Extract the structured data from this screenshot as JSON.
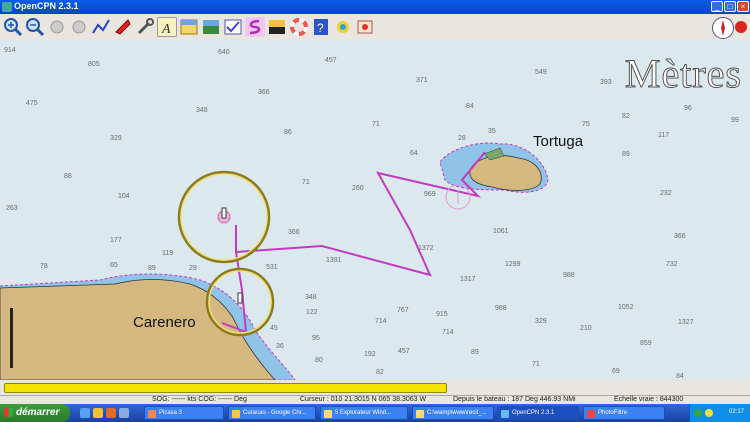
{
  "window": {
    "title": "OpenCPN 2.3.1"
  },
  "toolbar": {
    "buttons": [
      "zoom-in-icon",
      "zoom-out-icon",
      "scale-in-icon",
      "scale-out-icon",
      "route-icon",
      "follow-boat-icon",
      "settings-wrench-icon",
      "text-toggle-icon",
      "chart-quilt-icon",
      "current-icon",
      "tide-icon",
      "ais-icon",
      "track-icon",
      "color-scheme-icon",
      "man-overboard-icon",
      "help-icon",
      "plugin-icon",
      "print-icon"
    ]
  },
  "chart": {
    "units_label": "Mètres",
    "places": {
      "tortuga": "Tortuga",
      "carenero": "Carenero"
    },
    "soundings": [
      "914",
      "805",
      "640",
      "457",
      "371",
      "549",
      "393",
      "475",
      "348",
      "366",
      "84",
      "96",
      "75",
      "82",
      "99",
      "329",
      "86",
      "71",
      "28",
      "35",
      "117",
      "88",
      "64",
      "89",
      "263",
      "104",
      "71",
      "260",
      "969",
      "232",
      "177",
      "366",
      "1061",
      "119",
      "1372",
      "366",
      "78",
      "65",
      "89",
      "29",
      "531",
      "1391",
      "1299",
      "732",
      "1317",
      "988",
      "348",
      "122",
      "767",
      "915",
      "988",
      "1052",
      "714",
      "329",
      "210",
      "1327",
      "95",
      "45",
      "714",
      "36",
      "192",
      "457",
      "859",
      "80",
      "82",
      "89",
      "71",
      "69",
      "84"
    ],
    "colors": {
      "sea": "#dbe9ef",
      "land": "#d4b880",
      "shallow": "#8fc4e8",
      "route": "#c23bc2",
      "ring": "#8a7a20"
    }
  },
  "progress": {
    "fraction": 0.595
  },
  "status": {
    "sog": "SOG: ------ kts  COG: ------ Deg",
    "cursor": "Curseur : 010 21.3015 N 065 38.3063 W",
    "from_boat": "Depuis le bateau : 187 Deg  446.93 NMi",
    "scale": "Echelle vraie :  844300"
  },
  "taskbar": {
    "start": "démarrer",
    "tasks": [
      "Picasa 3",
      "Curacao - Google Chr...",
      "5 Explorateur Wind...",
      "C:\\wamp\\www\\recit_...",
      "OpenCPN 2.3.1",
      "PhotoFiltre"
    ],
    "clock": "02:17"
  }
}
